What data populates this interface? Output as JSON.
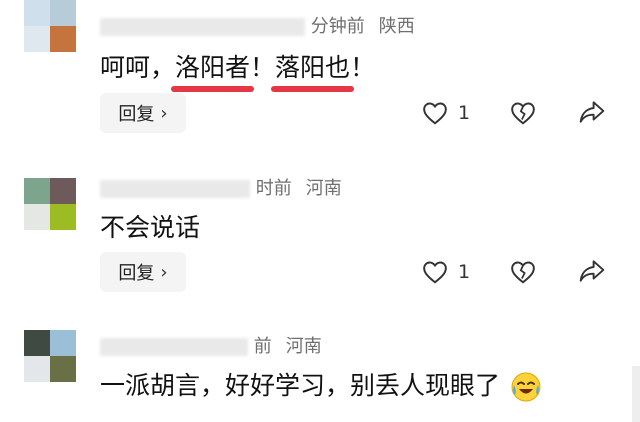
{
  "comments": [
    {
      "time": "分钟前",
      "location": "陕西",
      "text_before": "呵呵，",
      "highlight1": "洛阳者",
      "text_middle": "！",
      "highlight2": "落阳也",
      "text_after": "！",
      "reply_label": "回复",
      "like_count": "1",
      "avatar_colors": [
        "#cfe0ec",
        "#b7cbd8",
        "#c5743d",
        "#dfe8ee"
      ]
    },
    {
      "time": "时前",
      "location": "河南",
      "text": "不会说话",
      "reply_label": "回复",
      "like_count": "1",
      "avatar_colors": [
        "#7da48d",
        "#6e5a5a",
        "#e4e7e4",
        "#9dbb22"
      ]
    },
    {
      "time": "前",
      "location": "河南",
      "text": "一派胡言，好好学习，别丢人现眼了",
      "emoji": "crying-laughing-emoji",
      "avatar_colors": [
        "#3f4a43",
        "#9cbfd8",
        "#e3e7ea",
        "#6a7046"
      ]
    }
  ],
  "icons": {
    "like": "heart-outline-icon",
    "dislike": "broken-heart-icon",
    "share": "share-arrow-icon",
    "chevron": "chevron-right-icon"
  },
  "colors": {
    "highlight_underline": "#e63746",
    "meta_text": "#6f6f6f"
  }
}
